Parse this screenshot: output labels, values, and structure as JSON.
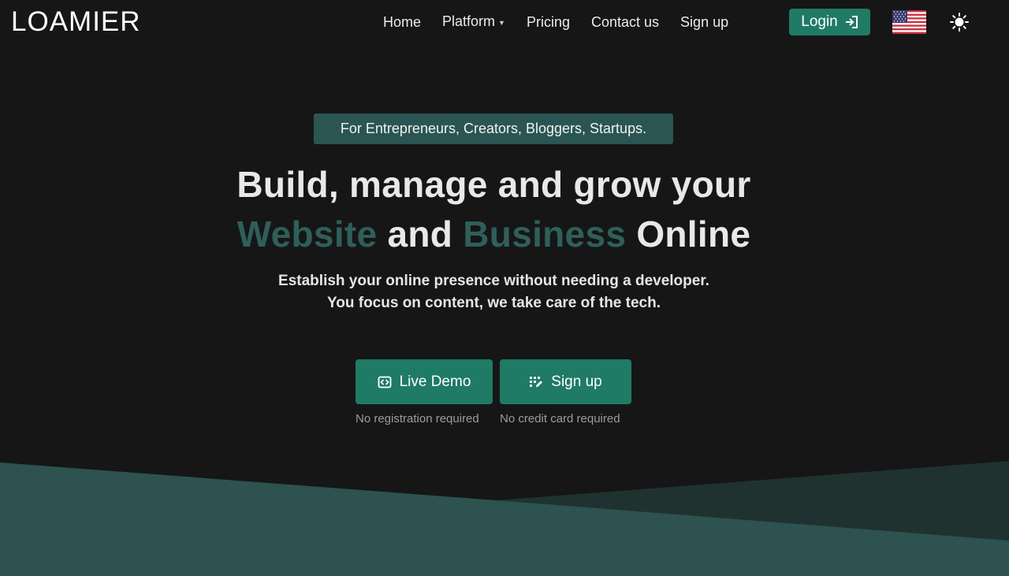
{
  "brand": {
    "logo_text": "LOAMIER"
  },
  "nav": {
    "items": [
      {
        "label": "Home"
      },
      {
        "label": "Platform",
        "has_dropdown": true
      },
      {
        "label": "Pricing"
      },
      {
        "label": "Contact us"
      },
      {
        "label": "Sign up"
      }
    ],
    "login_label": "Login",
    "login_icon": "sign-in-icon",
    "language_icon": "us-flag-icon",
    "theme_icon": "sun-icon"
  },
  "hero": {
    "badge": "For Entrepreneurs, Creators, Bloggers, Startups.",
    "title_line1": "Build, manage and grow your",
    "title_word1": "Website",
    "title_and": "and",
    "title_word2": "Business",
    "title_end": "Online",
    "subtitle_line1": "Establish your online presence without needing a developer.",
    "subtitle_line2": "You focus on content, we take care of the tech."
  },
  "cta": {
    "demo_label": "Live Demo",
    "demo_icon": "code-square-icon",
    "demo_note": "No registration required",
    "signup_label": "Sign up",
    "signup_icon": "pen-grid-icon",
    "signup_note": "No credit card required"
  },
  "colors": {
    "background": "#161616",
    "accent": "#1f7a66",
    "badge_bg": "#2b5553",
    "title_accent": "#2f5f59",
    "wave_light": "#2d5250",
    "wave_dark": "#1f3230"
  }
}
